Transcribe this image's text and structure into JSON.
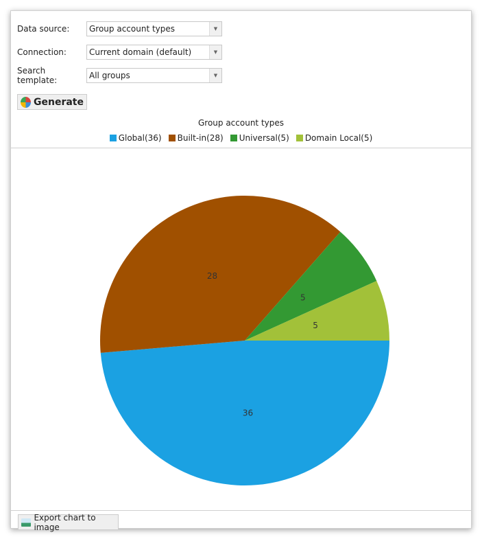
{
  "form": {
    "data_source": {
      "label": "Data source:",
      "value": "Group account types"
    },
    "connection": {
      "label": "Connection:",
      "value": "Current domain (default)"
    },
    "search_template": {
      "label": "Search template:",
      "value": "All groups"
    },
    "generate_label": "Generate"
  },
  "export_label": "Export chart to image",
  "icons": {
    "generate": "pie-chart-icon",
    "export": "image-icon",
    "dropdown": "chevron-down-icon"
  },
  "chart_data": {
    "type": "pie",
    "title": "Group account types",
    "categories": [
      "Global",
      "Built-in",
      "Universal",
      "Domain Local"
    ],
    "values": [
      36,
      28,
      5,
      5
    ],
    "legend_labels": [
      "Global(36)",
      "Built-in(28)",
      "Universal(5)",
      "Domain Local(5)"
    ],
    "colors": [
      "#1ba1e2",
      "#a05000",
      "#339933",
      "#a2c139"
    ],
    "legend": "top",
    "start_angle": "3 o'clock, clockwise"
  }
}
